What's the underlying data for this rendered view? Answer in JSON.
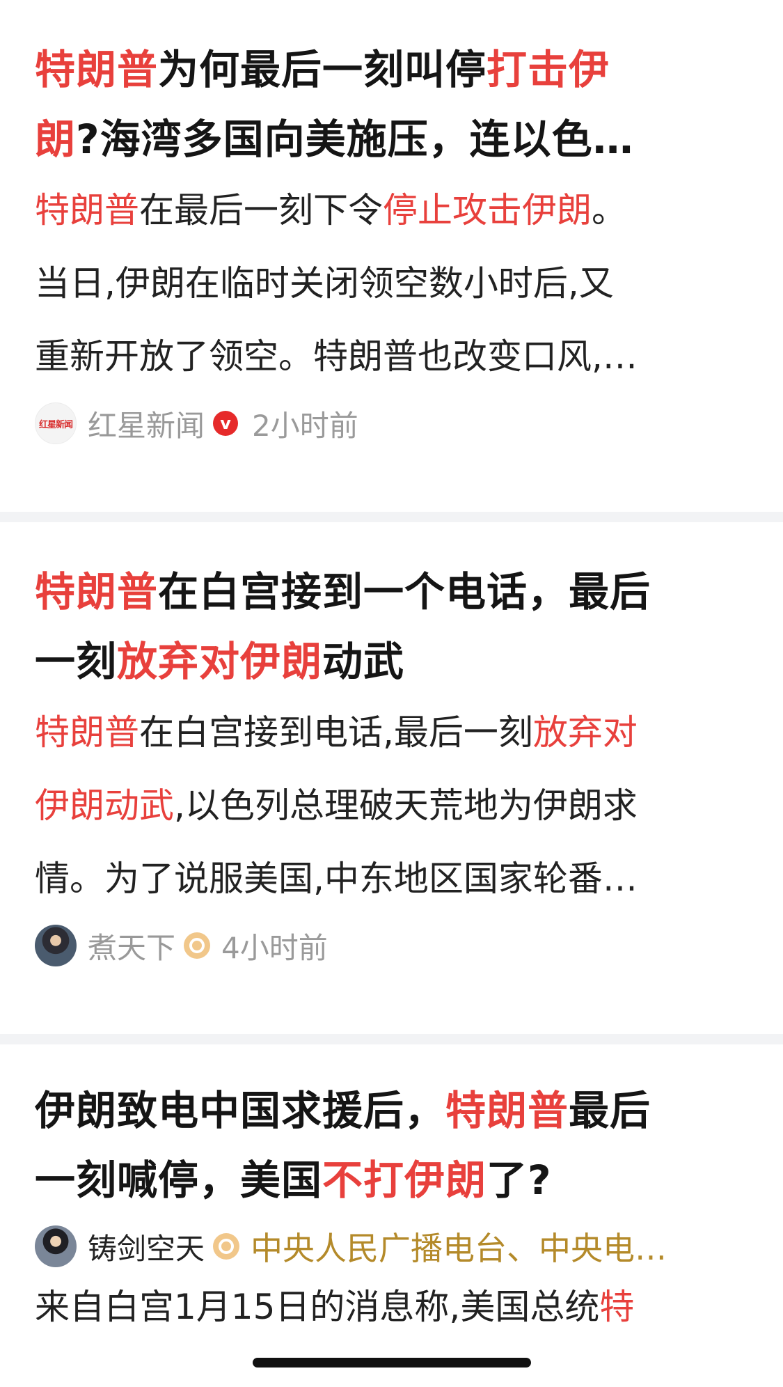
{
  "feed": [
    {
      "title_lines": [
        [
          {
            "t": "特朗普",
            "h": true
          },
          {
            "t": "为何最后一刻叫停",
            "h": false
          },
          {
            "t": "打击伊",
            "h": true
          }
        ],
        [
          {
            "t": "朗",
            "h": true
          },
          {
            "t": "?海湾多国向美施压，连以色…",
            "h": false
          }
        ]
      ],
      "summary_lines": [
        [
          {
            "t": "特朗普",
            "h": true
          },
          {
            "t": "在最后一刻下令",
            "h": false
          },
          {
            "t": "停止攻击伊朗",
            "h": true
          },
          {
            "t": "。",
            "h": false
          }
        ],
        [
          {
            "t": "当日,伊朗在临时关闭领空数小时后,又",
            "h": false
          }
        ],
        [
          {
            "t": "重新开放了领空。特朗普也改变口风,…",
            "h": false
          }
        ]
      ],
      "source": "红星新闻",
      "avatar_text": "红星新闻",
      "badge": "v",
      "time": "2小时前"
    },
    {
      "title_lines": [
        [
          {
            "t": "特朗普",
            "h": true
          },
          {
            "t": "在白宫接到一个电话，最后",
            "h": false
          }
        ],
        [
          {
            "t": "一刻",
            "h": false
          },
          {
            "t": "放弃对伊朗",
            "h": true
          },
          {
            "t": "动武",
            "h": false
          }
        ]
      ],
      "summary_lines": [
        [
          {
            "t": "特朗普",
            "h": true
          },
          {
            "t": "在白宫接到电话,最后一刻",
            "h": false
          },
          {
            "t": "放弃对",
            "h": true
          }
        ],
        [
          {
            "t": "伊朗动武",
            "h": true
          },
          {
            "t": ",以色列总理破天荒地为伊朗求",
            "h": false
          }
        ],
        [
          {
            "t": "情。为了说服美国,中东地区国家轮番…",
            "h": false
          }
        ]
      ],
      "source": "煮天下",
      "time": "4小时前"
    },
    {
      "title_lines": [
        [
          {
            "t": "伊朗致电中国求援后，",
            "h": false
          },
          {
            "t": "特朗普",
            "h": true
          },
          {
            "t": "最后",
            "h": false
          }
        ],
        [
          {
            "t": "一刻喊停，美国",
            "h": false
          },
          {
            "t": "不打伊朗",
            "h": true
          },
          {
            "t": "了?",
            "h": false
          }
        ]
      ],
      "source": "铸剑空天",
      "extra": "中央人民广播电台、中央电…",
      "summary_lines": [
        [
          {
            "t": "来自白宫1月15日的消息称,美国总统",
            "h": false
          },
          {
            "t": "特",
            "h": true
          }
        ]
      ]
    }
  ],
  "colors": {
    "highlight": "#e8403c",
    "text": "#151515",
    "muted": "#999999",
    "verified_red": "#e62a2a",
    "gold": "#b48a2a"
  }
}
